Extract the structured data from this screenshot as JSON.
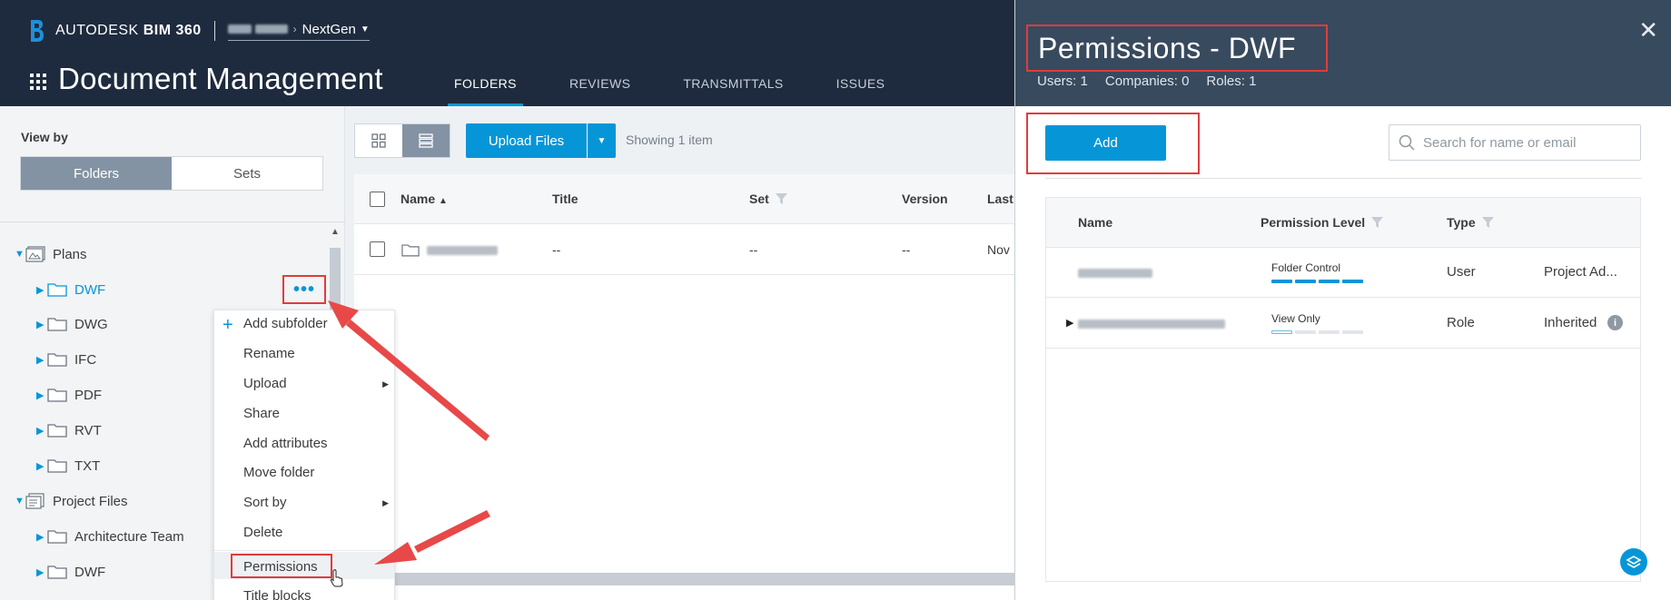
{
  "header": {
    "brand_prefix": "AUTODESK",
    "brand_product": "BIM 360",
    "project_name": "NextGen",
    "app_title": "Document Management",
    "tabs": [
      {
        "label": "FOLDERS",
        "active": true
      },
      {
        "label": "REVIEWS",
        "active": false
      },
      {
        "label": "TRANSMITTALS",
        "active": false
      },
      {
        "label": "ISSUES",
        "active": false
      }
    ]
  },
  "left_panel": {
    "view_by_label": "View by",
    "toggle": {
      "folders": "Folders",
      "sets": "Sets",
      "selected": "Folders"
    },
    "tree": [
      {
        "label": "Plans",
        "type": "project-root",
        "expanded": true
      },
      {
        "label": "DWF",
        "type": "folder",
        "active": true
      },
      {
        "label": "DWG",
        "type": "folder"
      },
      {
        "label": "IFC",
        "type": "folder"
      },
      {
        "label": "PDF",
        "type": "folder"
      },
      {
        "label": "RVT",
        "type": "folder"
      },
      {
        "label": "TXT",
        "type": "folder"
      },
      {
        "label": "Project Files",
        "type": "project-root",
        "expanded": true
      },
      {
        "label": "Architecture Team",
        "type": "folder"
      },
      {
        "label": "DWF",
        "type": "folder"
      }
    ],
    "more_button": "•••"
  },
  "context_menu": {
    "items": [
      {
        "label": "Add subfolder",
        "icon": "plus-icon"
      },
      {
        "label": "Rename"
      },
      {
        "label": "Upload",
        "submenu": true
      },
      {
        "label": "Share"
      },
      {
        "label": "Add attributes"
      },
      {
        "label": "Move folder"
      },
      {
        "label": "Sort by",
        "submenu": true
      },
      {
        "label": "Delete"
      },
      {
        "label": "Permissions",
        "highlighted": true
      },
      {
        "label": "Title blocks"
      }
    ]
  },
  "main": {
    "upload_label": "Upload Files",
    "showing_text": "Showing 1 item",
    "columns": [
      "Name",
      "Title",
      "Set",
      "Version",
      "Last"
    ],
    "rows": [
      {
        "name": "",
        "title": "--",
        "set": "--",
        "version": "--",
        "last": "Nov"
      }
    ]
  },
  "permissions_panel": {
    "title": "Permissions - DWF",
    "stats": {
      "users": "Users: 1",
      "companies": "Companies: 0",
      "roles": "Roles: 1"
    },
    "add_label": "Add",
    "search_placeholder": "Search for name or email",
    "columns": {
      "name": "Name",
      "permission_level": "Permission Level",
      "type": "Type"
    },
    "rows": [
      {
        "name": "",
        "level_label": "Folder Control",
        "level": 4,
        "type": "User",
        "extra": "Project Ad..."
      },
      {
        "name": "",
        "level_label": "View Only",
        "level": 1,
        "type": "Role",
        "extra": "Inherited"
      }
    ]
  },
  "colors": {
    "header_bg": "#1e2b3e",
    "panel_header_bg": "#384a5e",
    "accent": "#0696d7",
    "annotation_red": "#e23b3b"
  }
}
